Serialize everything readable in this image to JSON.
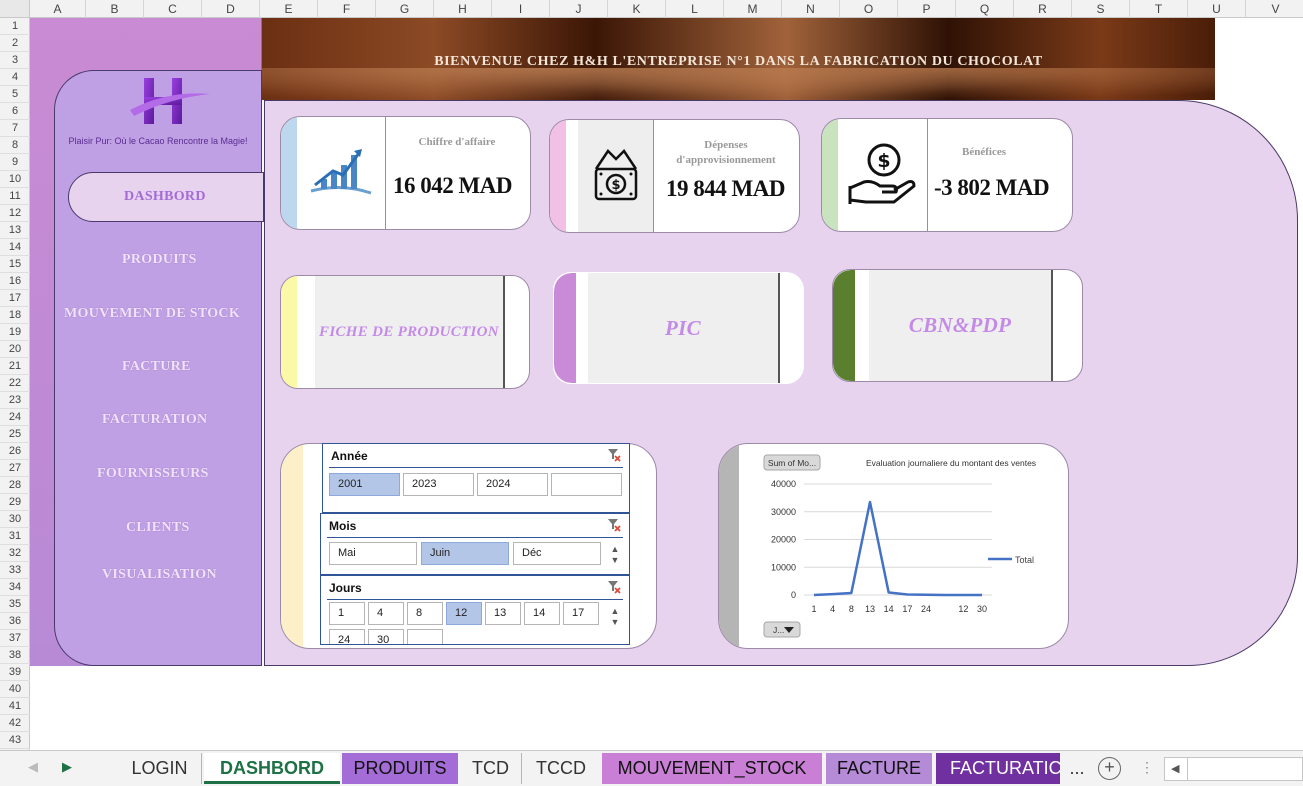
{
  "spreadsheet": {
    "columns": [
      "A",
      "B",
      "C",
      "D",
      "E",
      "F",
      "G",
      "H",
      "I",
      "J",
      "K",
      "L",
      "M",
      "N",
      "O",
      "P",
      "Q",
      "R",
      "S",
      "T",
      "U",
      "V"
    ],
    "rows": [
      "1",
      "2",
      "3",
      "4",
      "5",
      "6",
      "7",
      "8",
      "9",
      "10",
      "11",
      "12",
      "13",
      "14",
      "15",
      "16",
      "17",
      "18",
      "19",
      "20",
      "21",
      "22",
      "23",
      "24",
      "25",
      "26",
      "27",
      "28",
      "29",
      "30",
      "31",
      "32",
      "33",
      "34",
      "35",
      "36",
      "37",
      "38",
      "39",
      "40",
      "41",
      "42",
      "43"
    ]
  },
  "banner": {
    "title": "BIENVENUE CHEZ H&H L'ENTREPRISE N°1 DANS LA FABRICATION DU CHOCOLAT"
  },
  "sidebar": {
    "tagline": "Plaisir Pur: Où le Cacao Rencontre la Magie!",
    "items": [
      {
        "label": "DASHBORD"
      },
      {
        "label": "PRODUITS"
      },
      {
        "label": "MOUVEMENT DE STOCK"
      },
      {
        "label": "FACTURE"
      },
      {
        "label": "FACTURATION"
      },
      {
        "label": "FOURNISSEURS"
      },
      {
        "label": "CLIENTS"
      },
      {
        "label": "VISUALISATION"
      }
    ]
  },
  "kpis": [
    {
      "label": "Chiffre d'affaire",
      "value": "16 042 MAD",
      "accent": "#bcd7ee",
      "icon": "growth-chart-icon"
    },
    {
      "label_line1": "Dépenses",
      "label_line2": "d'approvisionnement",
      "value": "19 844 MAD",
      "accent": "#f2c0e4",
      "icon": "money-bag-icon"
    },
    {
      "label": "Bénéfices",
      "value": "-3 802 MAD",
      "accent": "#c8e3bd",
      "icon": "hand-coin-icon"
    }
  ],
  "buttons": [
    {
      "label": "FICHE DE PRODUCTION",
      "accent": "#fbf8a8"
    },
    {
      "label": "PIC",
      "accent": "#c98ad8"
    },
    {
      "label": "CBN&PDP",
      "accent": "#5a7f2e"
    }
  ],
  "slicers": {
    "annee": {
      "title": "Année",
      "items": [
        "2001",
        "2023",
        "2024",
        ""
      ],
      "selected": "2001"
    },
    "mois": {
      "title": "Mois",
      "items": [
        "Mai",
        "Juin",
        "Déc"
      ],
      "selected": "Juin"
    },
    "jours": {
      "title": "Jours",
      "items": [
        "1",
        "4",
        "8",
        "12",
        "13",
        "14",
        "17",
        "24",
        "30",
        ""
      ],
      "selected": "12"
    }
  },
  "chart": {
    "field_button": "Sum of Mo...",
    "axis_button": "J...",
    "legend_label": "Total"
  },
  "chart_data": {
    "type": "line",
    "title": "Evaluation journaliere du montant des ventes",
    "categories": [
      "1",
      "4",
      "8",
      "13",
      "14",
      "17",
      "24",
      "",
      "12",
      "30"
    ],
    "series": [
      {
        "name": "Total",
        "values": [
          0,
          300,
          700,
          33500,
          900,
          200,
          100,
          0,
          0,
          0
        ]
      }
    ],
    "ylim": [
      0,
      40000
    ],
    "yticks": [
      "0",
      "10000",
      "20000",
      "30000",
      "40000"
    ],
    "grid": true,
    "legend": "right",
    "color": "#4472c4"
  },
  "tabs": [
    {
      "label": "LOGIN"
    },
    {
      "label": "DASHBORD"
    },
    {
      "label": "PRODUITS"
    },
    {
      "label": "TCD"
    },
    {
      "label": "TCCD"
    },
    {
      "label": "MOUVEMENT_STOCK"
    },
    {
      "label": "FACTURE"
    },
    {
      "label": "FACTURATIC"
    },
    {
      "label": "..."
    }
  ]
}
